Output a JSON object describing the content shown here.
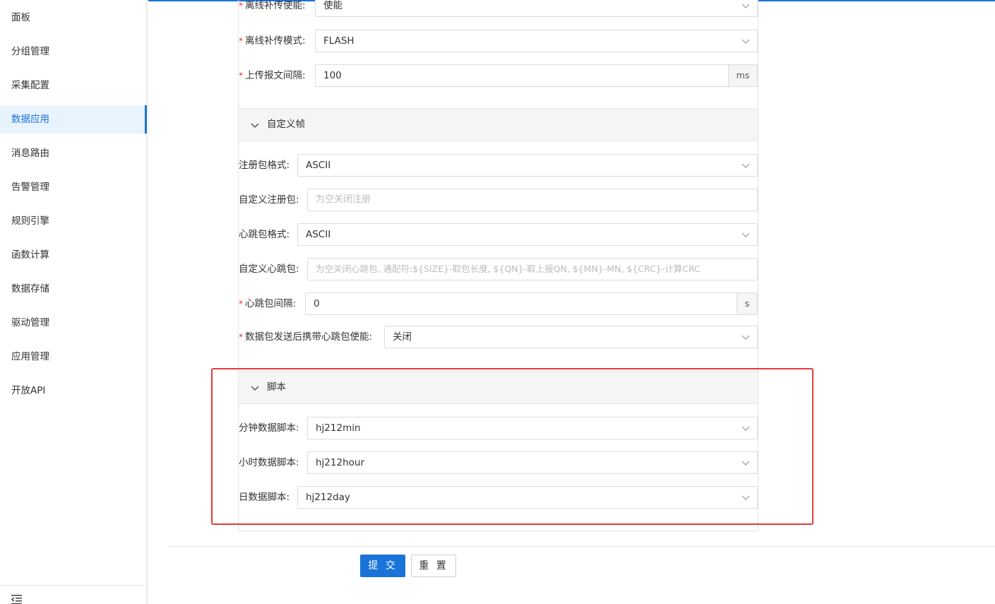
{
  "sidebar": {
    "items": [
      {
        "label": "面板"
      },
      {
        "label": "分组管理"
      },
      {
        "label": "采集配置"
      },
      {
        "label": "数据应用"
      },
      {
        "label": "消息路由"
      },
      {
        "label": "告警管理"
      },
      {
        "label": "规则引擎"
      },
      {
        "label": "函数计算"
      },
      {
        "label": "数据存储"
      },
      {
        "label": "驱动管理"
      },
      {
        "label": "应用管理"
      },
      {
        "label": "开放API"
      }
    ],
    "active_index": 3
  },
  "form": {
    "offline_enable": {
      "label": "离线补传使能:",
      "value": "使能"
    },
    "offline_mode": {
      "label": "离线补传模式:",
      "value": "FLASH"
    },
    "upload_interval": {
      "label": "上传报文间隔:",
      "value": "100",
      "unit": "ms"
    },
    "custom_frame": {
      "title": "自定义帧",
      "register_format": {
        "label": "注册包格式:",
        "value": "ASCII"
      },
      "custom_register": {
        "label": "自定义注册包:",
        "placeholder": "为空关闭注册"
      },
      "heartbeat_format": {
        "label": "心跳包格式:",
        "value": "ASCII"
      },
      "custom_heartbeat": {
        "label": "自定义心跳包:",
        "placeholder": "为空关闭心跳包, 通配符:${SIZE}-取包长度, ${QN}-取上报QN, ${MN}-MN, ${CRC}-计算CRC"
      },
      "heartbeat_interval": {
        "label": "心跳包间隔:",
        "value": "0",
        "unit": "s"
      },
      "heartbeat_after_data": {
        "label": "数据包发送后携带心跳包使能:",
        "value": "关闭"
      }
    },
    "script": {
      "title": "脚本",
      "minute": {
        "label": "分钟数据脚本:",
        "value": "hj212min"
      },
      "hour": {
        "label": "小时数据脚本:",
        "value": "hj212hour"
      },
      "day": {
        "label": "日数据脚本:",
        "value": "hj212day"
      }
    }
  },
  "actions": {
    "submit": "提 交",
    "reset": "重 置"
  }
}
